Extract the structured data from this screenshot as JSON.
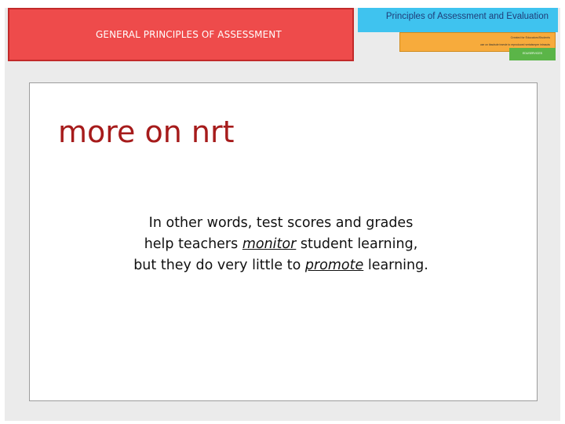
{
  "header": {
    "section_title": "GENERAL PRINCIPLES OF ASSESSMENT",
    "course_title": {
      "part1": "Principles ",
      "part2": "of ",
      "part3": "Assessment ",
      "part4": "and ",
      "part5": "Evaluation"
    },
    "orange_line1": "Created for Educators/Students",
    "orange_line2": "use on tlasdsde trsesle to reproduced vertatsmper intrasots",
    "green_tag": "EDUSERVICES"
  },
  "slide": {
    "heading": "more on nrt",
    "body": {
      "line1": "In other words, test scores and grades",
      "line2_pre": "help teachers ",
      "line2_emph": "monitor",
      "line2_post": " student learning,",
      "line3_pre": "but they do very little to ",
      "line3_emph": "promote",
      "line3_post": " learning."
    }
  },
  "colors": {
    "red_banner": "#ee4b4b",
    "blue_bar": "#3fc3ef",
    "orange_box": "#f7ab3c",
    "green_tag": "#5bb548",
    "heading": "#a61b1b"
  }
}
